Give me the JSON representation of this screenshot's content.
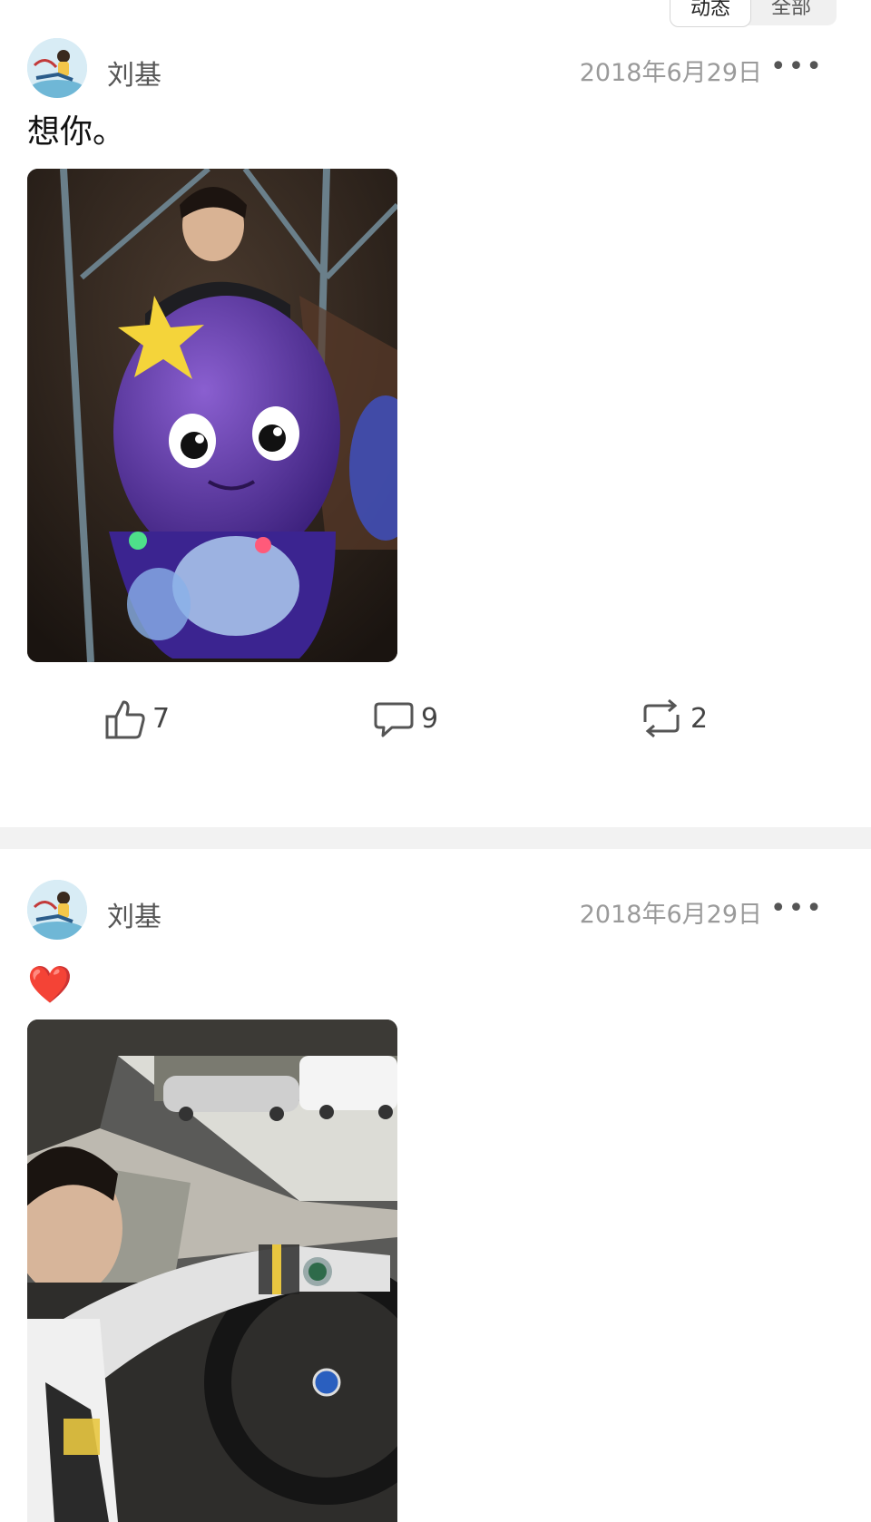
{
  "tabs": [
    {
      "label": "动态"
    },
    {
      "label": "全部"
    }
  ],
  "posts": [
    {
      "author": "刘基",
      "date": "2018年6月29日",
      "more": "•••",
      "text": "想你。",
      "image_icon": "photo-octopus-ride",
      "likes": "7",
      "comments": "9",
      "reposts": "2"
    },
    {
      "author": "刘基",
      "date": "2018年6月29日",
      "more": "•••",
      "text": "❤️",
      "image_icon": "photo-car-interior"
    }
  ],
  "colors": {
    "date": "#9a9a9a",
    "author": "#555555",
    "divider": "#f2f2f2",
    "heart": "#e23a3a"
  }
}
